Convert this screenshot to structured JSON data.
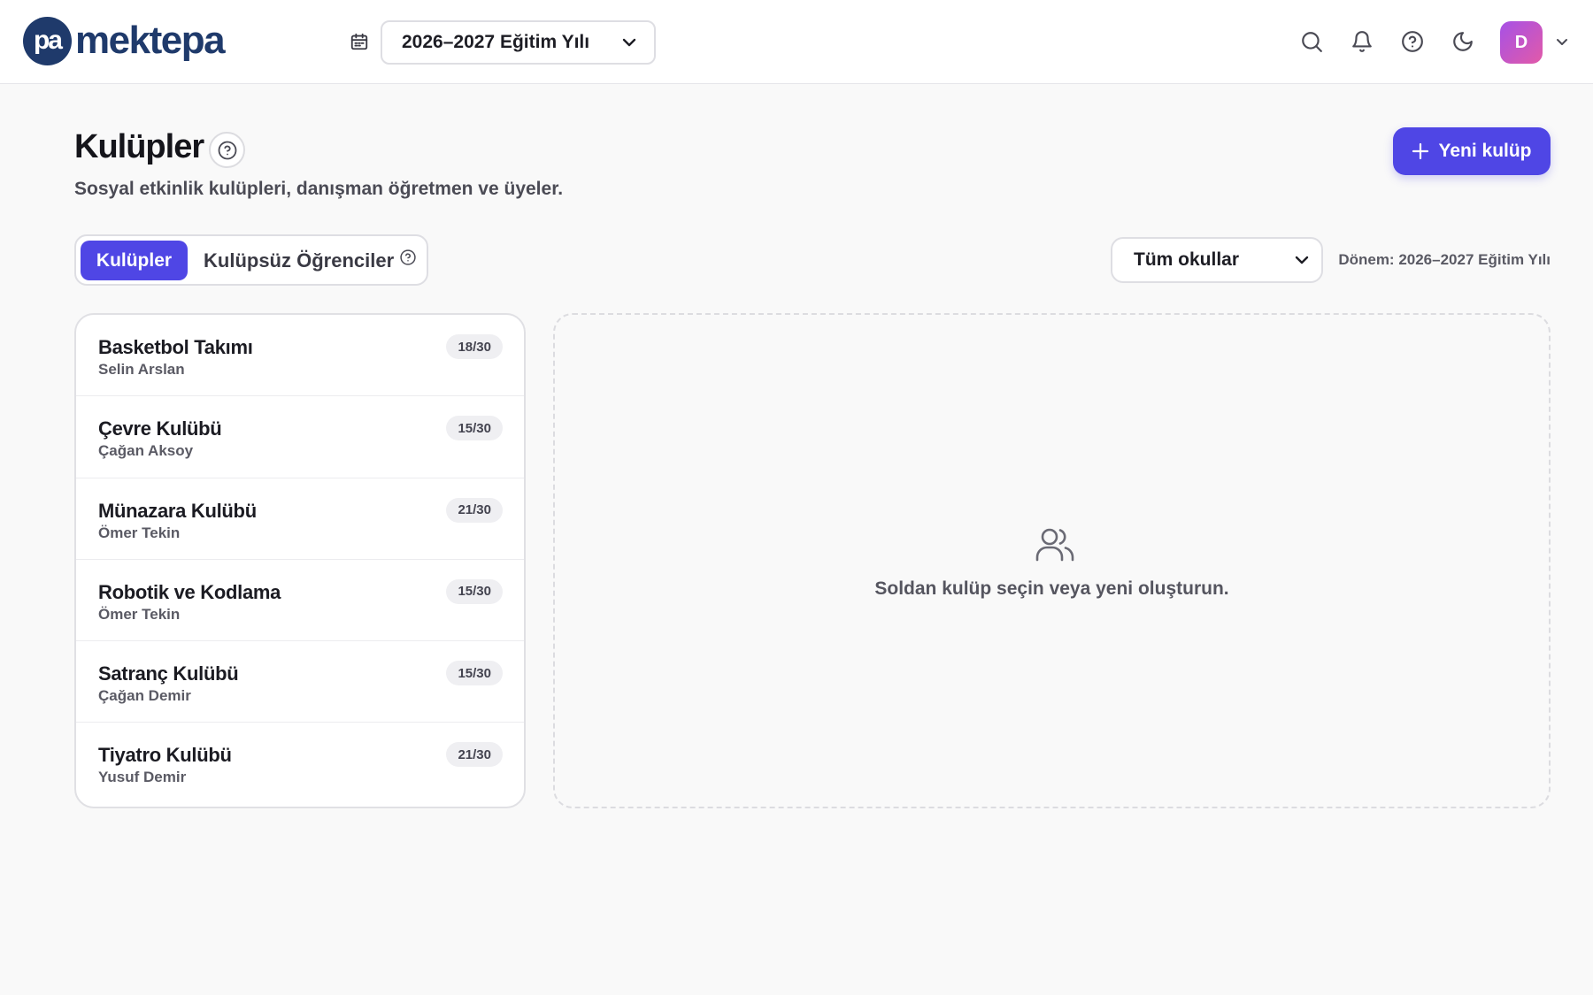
{
  "brand": {
    "logo_mark": "pa",
    "name": "mektepa"
  },
  "topbar": {
    "academic_year": "2026–2027 Eğitim Yılı",
    "avatar_initial": "D",
    "icons": [
      "calendar-icon",
      "search-icon",
      "bell-icon",
      "help-icon",
      "moon-icon",
      "chevron-down-icon"
    ]
  },
  "header": {
    "title": "Kulüpler",
    "subtitle": "Sosyal etkinlik kulüpleri, danışman öğretmen ve üyeler.",
    "new_button": "Yeni kulüp"
  },
  "tabs": {
    "active": "Kulüpler",
    "inactive": "Kulüpsüz Öğrenciler"
  },
  "filters": {
    "school": "Tüm okullar",
    "term": "Dönem: 2026–2027 Eğitim Yılı"
  },
  "clubs": [
    {
      "name": "Basketbol Takımı",
      "advisor": "Selin Arslan",
      "count": "18/30"
    },
    {
      "name": "Çevre Kulübü",
      "advisor": "Çağan Aksoy",
      "count": "15/30"
    },
    {
      "name": "Münazara Kulübü",
      "advisor": "Ömer Tekin",
      "count": "21/30"
    },
    {
      "name": "Robotik ve Kodlama",
      "advisor": "Ömer Tekin",
      "count": "15/30"
    },
    {
      "name": "Satranç Kulübü",
      "advisor": "Çağan Demir",
      "count": "15/30"
    },
    {
      "name": "Tiyatro Kulübü",
      "advisor": "Yusuf Demir",
      "count": "21/30"
    }
  ],
  "detail": {
    "empty_message": "Soldan kulüp seçin veya yeni oluşturun."
  },
  "colors": {
    "accent": "#4f46e5",
    "brand": "#1f3a6b"
  }
}
